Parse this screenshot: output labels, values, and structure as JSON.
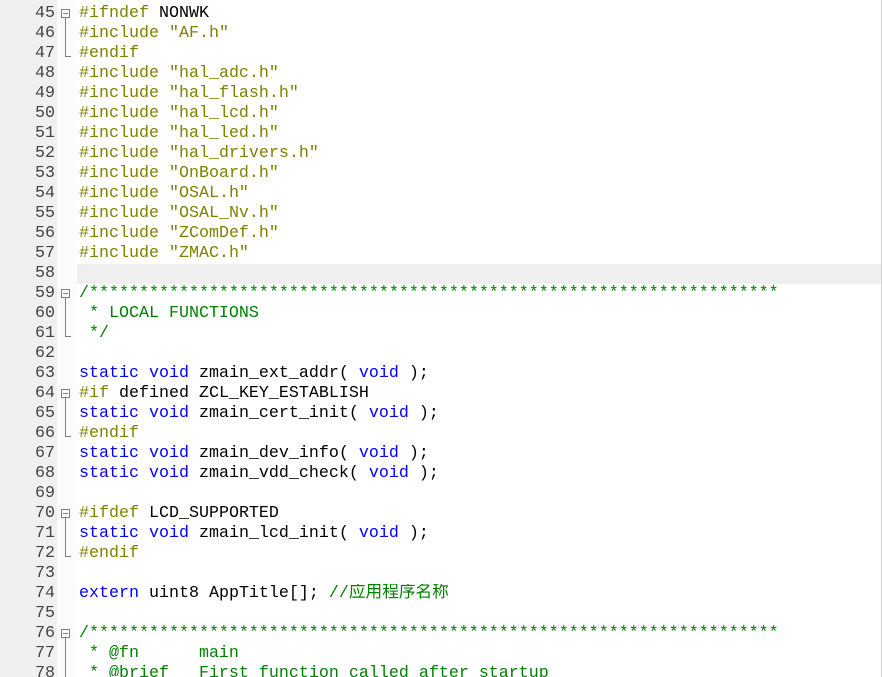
{
  "editor": {
    "syntax_colors": {
      "text": "#000000",
      "keyword": "#0000ff",
      "preprocessor": "#808000",
      "string": "#808000",
      "comment": "#008000"
    },
    "ui_colors": {
      "background": "#ffffff",
      "gutter_background": "#f0f0f0",
      "line_number": "#444444",
      "fold_margin_background": "#fcfcfc",
      "fold_marker": "#808080",
      "current_line_background": "#efefef"
    },
    "lines": [
      {
        "number": "45",
        "fold": "fold-collapse-icon",
        "tokens": [
          {
            "preprocessor": "#ifndef"
          },
          {
            "text": " NONWK"
          }
        ]
      },
      {
        "number": "46",
        "fold": "fold-line-icon",
        "tokens": [
          {
            "preprocessor": "#include "
          },
          {
            "string": "\"AF.h\""
          }
        ]
      },
      {
        "number": "47",
        "fold": "fold-end-icon",
        "tokens": [
          {
            "preprocessor": "#endif"
          }
        ]
      },
      {
        "number": "48",
        "tokens": [
          {
            "preprocessor": "#include "
          },
          {
            "string": "\"hal_adc.h\""
          }
        ]
      },
      {
        "number": "49",
        "tokens": [
          {
            "preprocessor": "#include "
          },
          {
            "string": "\"hal_flash.h\""
          }
        ]
      },
      {
        "number": "50",
        "tokens": [
          {
            "preprocessor": "#include "
          },
          {
            "string": "\"hal_lcd.h\""
          }
        ]
      },
      {
        "number": "51",
        "tokens": [
          {
            "preprocessor": "#include "
          },
          {
            "string": "\"hal_led.h\""
          }
        ]
      },
      {
        "number": "52",
        "tokens": [
          {
            "preprocessor": "#include "
          },
          {
            "string": "\"hal_drivers.h\""
          }
        ]
      },
      {
        "number": "53",
        "tokens": [
          {
            "preprocessor": "#include "
          },
          {
            "string": "\"OnBoard.h\""
          }
        ]
      },
      {
        "number": "54",
        "tokens": [
          {
            "preprocessor": "#include "
          },
          {
            "string": "\"OSAL.h\""
          }
        ]
      },
      {
        "number": "55",
        "tokens": [
          {
            "preprocessor": "#include "
          },
          {
            "string": "\"OSAL_Nv.h\""
          }
        ]
      },
      {
        "number": "56",
        "tokens": [
          {
            "preprocessor": "#include "
          },
          {
            "string": "\"ZComDef.h\""
          }
        ]
      },
      {
        "number": "57",
        "tokens": [
          {
            "preprocessor": "#include "
          },
          {
            "string": "\"ZMAC.h\""
          }
        ]
      },
      {
        "number": "58",
        "current": true,
        "tokens": []
      },
      {
        "number": "59",
        "fold": "fold-collapse-icon",
        "tokens": [
          {
            "comment": "/*********************************************************************"
          }
        ]
      },
      {
        "number": "60",
        "fold": "fold-line-icon",
        "tokens": [
          {
            "comment": " * LOCAL FUNCTIONS"
          }
        ]
      },
      {
        "number": "61",
        "fold": "fold-end-icon",
        "tokens": [
          {
            "comment": " */"
          }
        ]
      },
      {
        "number": "62",
        "tokens": []
      },
      {
        "number": "63",
        "tokens": [
          {
            "keyword": "static"
          },
          {
            "text": " "
          },
          {
            "keyword": "void"
          },
          {
            "text": " zmain_ext_addr( "
          },
          {
            "keyword": "void"
          },
          {
            "text": " );"
          }
        ]
      },
      {
        "number": "64",
        "fold": "fold-collapse-icon",
        "tokens": [
          {
            "preprocessor": "#if"
          },
          {
            "text": " defined ZCL_KEY_ESTABLISH"
          }
        ]
      },
      {
        "number": "65",
        "fold": "fold-line-icon",
        "tokens": [
          {
            "keyword": "static"
          },
          {
            "text": " "
          },
          {
            "keyword": "void"
          },
          {
            "text": " zmain_cert_init( "
          },
          {
            "keyword": "void"
          },
          {
            "text": " );"
          }
        ]
      },
      {
        "number": "66",
        "fold": "fold-end-icon",
        "tokens": [
          {
            "preprocessor": "#endif"
          }
        ]
      },
      {
        "number": "67",
        "tokens": [
          {
            "keyword": "static"
          },
          {
            "text": " "
          },
          {
            "keyword": "void"
          },
          {
            "text": " zmain_dev_info( "
          },
          {
            "keyword": "void"
          },
          {
            "text": " );"
          }
        ]
      },
      {
        "number": "68",
        "tokens": [
          {
            "keyword": "static"
          },
          {
            "text": " "
          },
          {
            "keyword": "void"
          },
          {
            "text": " zmain_vdd_check( "
          },
          {
            "keyword": "void"
          },
          {
            "text": " );"
          }
        ]
      },
      {
        "number": "69",
        "tokens": []
      },
      {
        "number": "70",
        "fold": "fold-collapse-icon",
        "tokens": [
          {
            "preprocessor": "#ifdef"
          },
          {
            "text": " LCD_SUPPORTED"
          }
        ]
      },
      {
        "number": "71",
        "fold": "fold-line-icon",
        "tokens": [
          {
            "keyword": "static"
          },
          {
            "text": " "
          },
          {
            "keyword": "void"
          },
          {
            "text": " zmain_lcd_init( "
          },
          {
            "keyword": "void"
          },
          {
            "text": " );"
          }
        ]
      },
      {
        "number": "72",
        "fold": "fold-end-icon",
        "tokens": [
          {
            "preprocessor": "#endif"
          }
        ]
      },
      {
        "number": "73",
        "tokens": []
      },
      {
        "number": "74",
        "tokens": [
          {
            "keyword": "extern"
          },
          {
            "text": " uint8 AppTitle[]; "
          },
          {
            "comment": "//应用程序名称"
          }
        ]
      },
      {
        "number": "75",
        "tokens": []
      },
      {
        "number": "76",
        "fold": "fold-collapse-icon",
        "tokens": [
          {
            "comment": "/*********************************************************************"
          }
        ]
      },
      {
        "number": "77",
        "fold": "fold-line-icon",
        "tokens": [
          {
            "comment": " * @fn      main"
          }
        ]
      },
      {
        "number": "78",
        "fold": "fold-line-icon",
        "tokens": [
          {
            "comment": " * @brief   First function called after startup"
          }
        ]
      }
    ]
  }
}
